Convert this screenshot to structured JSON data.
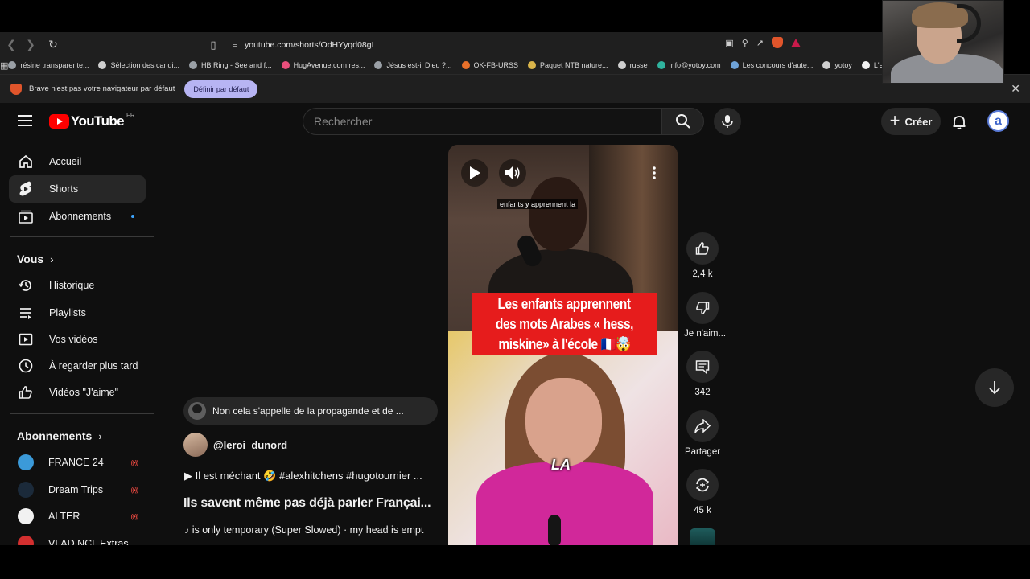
{
  "browser": {
    "url": "youtube.com/shorts/OdHYyqd08gI",
    "bookmarks": [
      {
        "label": "résine transparente...",
        "color": "#9aa0a6"
      },
      {
        "label": "Sélection des candi...",
        "color": "#cfcfcf"
      },
      {
        "label": "HB Ring - See and f...",
        "color": "#9aa0a6"
      },
      {
        "label": "HugAvenue.com res...",
        "color": "#e94f7c"
      },
      {
        "label": "Jésus est-il Dieu ?...",
        "color": "#9aa0a6"
      },
      {
        "label": "OK-FB-URSS",
        "color": "#e8702a"
      },
      {
        "label": "Paquet NTB nature...",
        "color": "#d9b44a"
      },
      {
        "label": "russe",
        "color": "#cfcfcf"
      },
      {
        "label": "info@yotoy.com",
        "color": "#2fb39e"
      },
      {
        "label": "Les concours d'aute...",
        "color": "#6fa3d8"
      },
      {
        "label": "yotoy",
        "color": "#cfcfcf"
      },
      {
        "label": "L'esquif fantôme eB...",
        "color": "#f1f1f1"
      }
    ],
    "infobar": {
      "message": "Brave n'est pas votre navigateur par défaut",
      "button": "Définir par défaut"
    }
  },
  "youtube": {
    "logo_text": "YouTube",
    "country_code": "FR",
    "search_placeholder": "Rechercher",
    "create_label": "Créer",
    "avatar_letter": "a",
    "sidebar": {
      "main": [
        {
          "label": "Accueil",
          "icon": "home-icon"
        },
        {
          "label": "Shorts",
          "icon": "shorts-icon",
          "active": true
        },
        {
          "label": "Abonnements",
          "icon": "subscriptions-icon",
          "new_dot": true
        }
      ],
      "you_header": "Vous",
      "you": [
        {
          "label": "Historique",
          "icon": "history-icon"
        },
        {
          "label": "Playlists",
          "icon": "playlists-icon"
        },
        {
          "label": "Vos vidéos",
          "icon": "your-videos-icon"
        },
        {
          "label": "À regarder plus tard",
          "icon": "watch-later-icon"
        },
        {
          "label": "Vidéos \"J'aime\"",
          "icon": "liked-videos-icon"
        }
      ],
      "subs_header": "Abonnements",
      "subs": [
        {
          "label": "FRANCE 24",
          "color": "#3b9ad9",
          "live": "((•))"
        },
        {
          "label": "Dream Trips",
          "color": "#1b2a3a",
          "live": "((•))"
        },
        {
          "label": "ALTER",
          "color": "#f1f1f1",
          "live": "((•))"
        },
        {
          "label": "VLAD NCL Extras",
          "color": "#d32f2f"
        }
      ]
    },
    "short": {
      "subtitle": "enfants y apprennent la",
      "banner_lines": [
        "Les enfants apprennent",
        "des mots Arabes « hess,",
        "miskine» à l'école 🇫🇷🤯"
      ],
      "caption": "LA",
      "comment_preview": "Non cela s'appelle de la propagande et de ...",
      "channel": "@leroi_dunord",
      "description": "▶  Il est méchant 🤣 #alexhitchens #hugotournier ...",
      "title": "Ils savent même pas déjà parler Françai...",
      "music": "♪ is only temporary (Super Slowed) · my head is empt"
    },
    "actions": {
      "likes": "2,4 k",
      "dislike": "Je n'aim...",
      "comments": "342",
      "share": "Partager",
      "remix": "45 k"
    }
  }
}
